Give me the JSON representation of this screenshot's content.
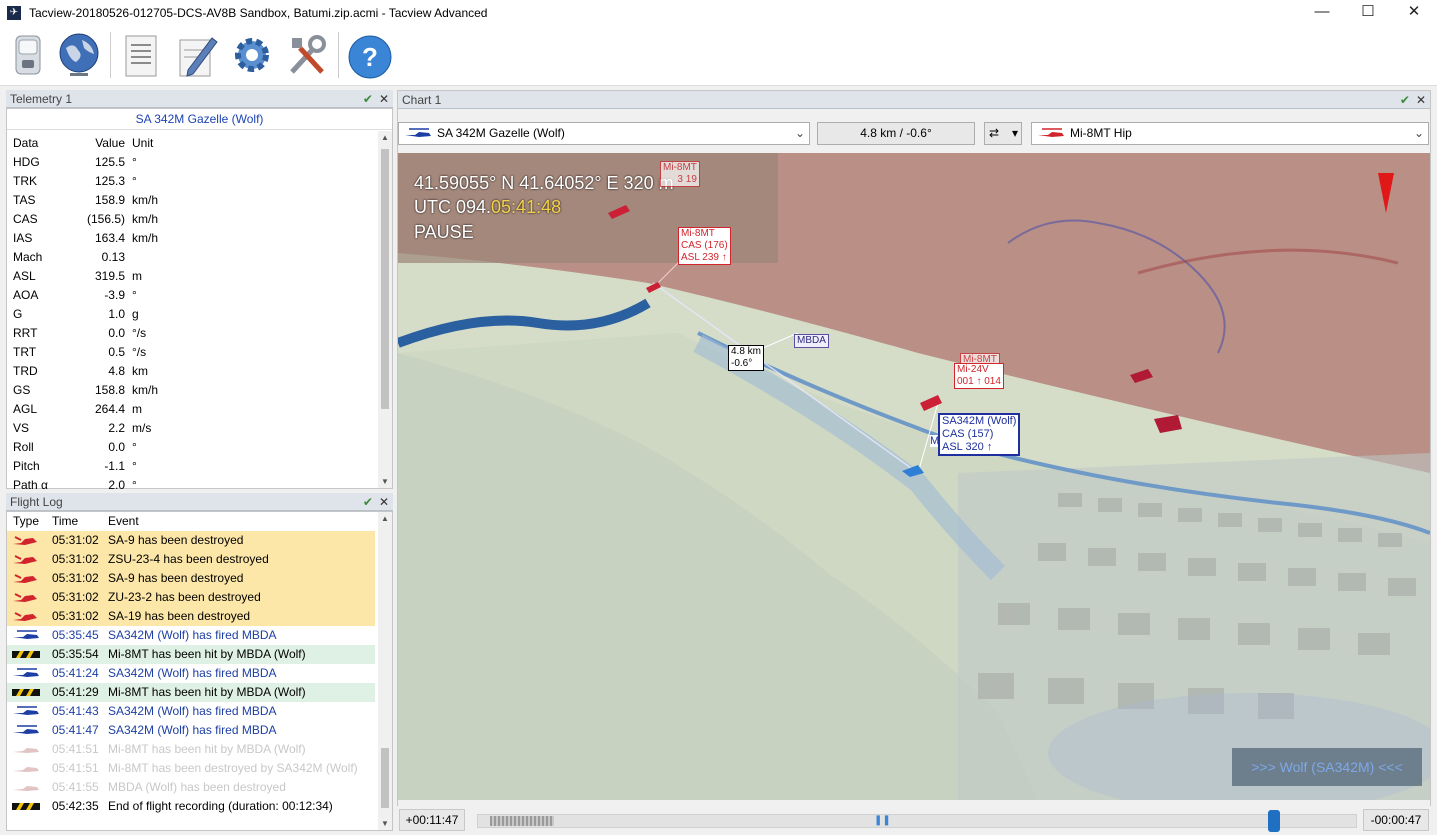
{
  "window": {
    "title": "Tacview-20180526-012705-DCS-AV8B Sandbox, Batumi.zip.acmi - Tacview Advanced",
    "minimize": "—",
    "maximize": "☐",
    "close": "✕"
  },
  "toolbar": {
    "buttons": [
      {
        "name": "open-file-icon"
      },
      {
        "name": "globe-icon"
      },
      {
        "name": "document-icon"
      },
      {
        "name": "edit-icon"
      },
      {
        "name": "settings-gear-icon"
      },
      {
        "name": "tools-icon"
      },
      {
        "name": "help-icon",
        "label": "?"
      }
    ]
  },
  "telemetry": {
    "title": "Telemetry 1",
    "object": "SA 342M Gazelle (Wolf)",
    "headers": {
      "data": "Data",
      "value": "Value",
      "unit": "Unit"
    },
    "rows": [
      {
        "data": "HDG",
        "value": "125.5",
        "unit": "°"
      },
      {
        "data": "TRK",
        "value": "125.3",
        "unit": "°"
      },
      {
        "data": "TAS",
        "value": "158.9",
        "unit": "km/h"
      },
      {
        "data": "CAS",
        "value": "(156.5)",
        "unit": "km/h"
      },
      {
        "data": "IAS",
        "value": "163.4",
        "unit": "km/h"
      },
      {
        "data": "Mach",
        "value": "0.13",
        "unit": ""
      },
      {
        "data": "ASL",
        "value": "319.5",
        "unit": "m"
      },
      {
        "data": "AOA",
        "value": "-3.9",
        "unit": "°"
      },
      {
        "data": "G",
        "value": "1.0",
        "unit": "g"
      },
      {
        "data": "RRT",
        "value": "0.0",
        "unit": "°/s"
      },
      {
        "data": "TRT",
        "value": "0.5",
        "unit": "°/s"
      },
      {
        "data": "TRD",
        "value": "4.8",
        "unit": "km"
      },
      {
        "data": "GS",
        "value": "158.8",
        "unit": "km/h"
      },
      {
        "data": "AGL",
        "value": "264.4",
        "unit": "m"
      },
      {
        "data": "VS",
        "value": "2.2",
        "unit": "m/s"
      },
      {
        "data": "Roll",
        "value": "0.0",
        "unit": "°"
      },
      {
        "data": "Pitch",
        "value": "-1.1",
        "unit": "°"
      },
      {
        "data": "Path α",
        "value": "2.0",
        "unit": "°"
      }
    ]
  },
  "flight_log": {
    "title": "Flight Log",
    "headers": {
      "type": "Type",
      "time": "Time",
      "event": "Event"
    },
    "rows": [
      {
        "kind": "destroyed",
        "time": "05:31:02",
        "event": "SA-9 has been destroyed"
      },
      {
        "kind": "destroyed",
        "time": "05:31:02",
        "event": "ZSU-23-4 has been destroyed"
      },
      {
        "kind": "destroyed",
        "time": "05:31:02",
        "event": "SA-9 has been destroyed"
      },
      {
        "kind": "destroyed",
        "time": "05:31:02",
        "event": "ZU-23-2 has been destroyed"
      },
      {
        "kind": "destroyed",
        "time": "05:31:02",
        "event": "SA-19 has been destroyed"
      },
      {
        "kind": "fired",
        "time": "05:35:45",
        "event": "SA342M (Wolf) has fired MBDA"
      },
      {
        "kind": "hit",
        "time": "05:35:54",
        "event": "Mi-8MT has been hit by MBDA (Wolf)"
      },
      {
        "kind": "fired",
        "time": "05:41:24",
        "event": "SA342M (Wolf) has fired MBDA"
      },
      {
        "kind": "hit",
        "time": "05:41:29",
        "event": "Mi-8MT has been hit by MBDA (Wolf)"
      },
      {
        "kind": "fired",
        "time": "05:41:43",
        "event": "SA342M (Wolf) has fired MBDA"
      },
      {
        "kind": "fired",
        "time": "05:41:47",
        "event": "SA342M (Wolf) has fired MBDA"
      },
      {
        "kind": "faded",
        "time": "05:41:51",
        "event": "Mi-8MT has been hit by MBDA (Wolf)"
      },
      {
        "kind": "faded",
        "time": "05:41:51",
        "event": "Mi-8MT has been destroyed by SA342M (Wolf)"
      },
      {
        "kind": "faded",
        "time": "05:41:55",
        "event": "MBDA (Wolf) has been destroyed"
      },
      {
        "kind": "end",
        "time": "05:42:35",
        "event": "End of flight recording (duration: 00:12:34)"
      }
    ]
  },
  "chart": {
    "title": "Chart 1",
    "primary_object": "SA 342M Gazelle (Wolf)",
    "range_bearing": "4.8 km / -0.6°",
    "secondary_object": "Mi-8MT Hip",
    "hud": {
      "coords": "41.59055° N  41.64052° E  320 m",
      "utc_prefix": "UTC 094.",
      "utc_time": "05:41:48",
      "state": "PAUSE"
    },
    "labels": {
      "mi8_top_1": "Mi-8MT",
      "mi8_top_2": "3 19",
      "mi8_main_1": "Mi-8MT",
      "mi8_main_2": "CAS (176)",
      "mi8_main_3": "ASL 239 ↑",
      "range_1": "4.8 km",
      "range_2": "-0.6°",
      "mbda": "MBDA",
      "mi24_back": "Mi-8MT",
      "mi24_1": "Mi-24V",
      "mi24_2": "001 ↑ 014",
      "wolf_1": "SA342M (Wolf)",
      "wolf_2": "CAS (157)",
      "wolf_3": "ASL 320 ↑",
      "m_tag": "M"
    },
    "focus_name": ">>> Wolf (SA342M) <<<"
  },
  "timeline": {
    "elapsed": "+00:11:47",
    "remaining": "-00:00:47",
    "progress_fraction": 0.94
  }
}
